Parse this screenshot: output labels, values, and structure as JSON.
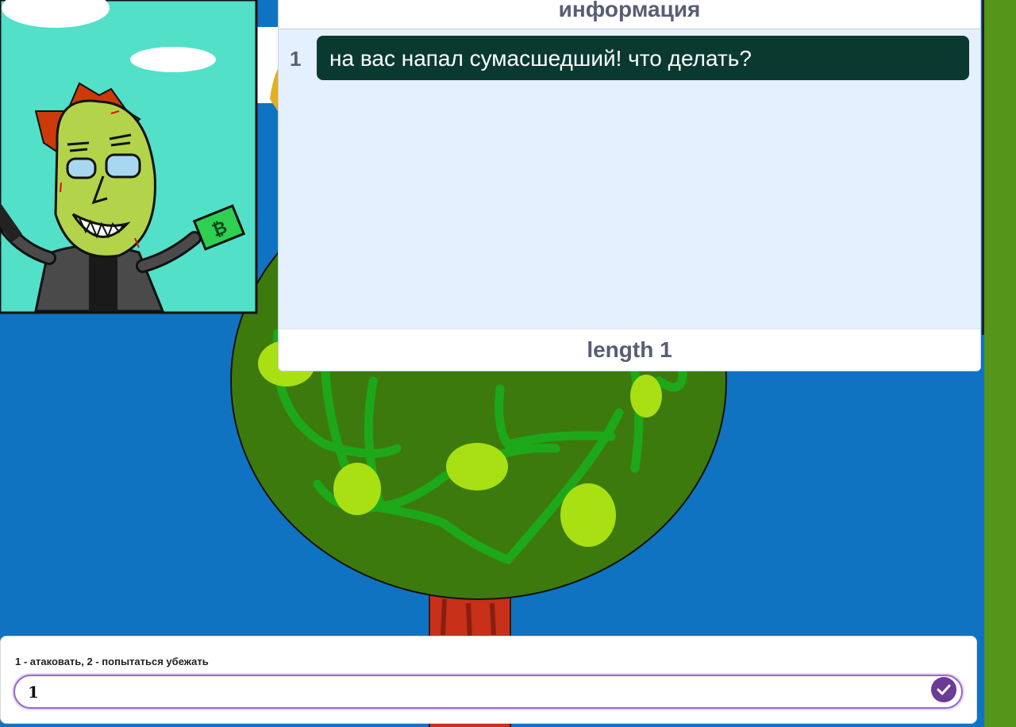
{
  "list_monitor": {
    "title": "информация",
    "items": [
      {
        "index": "1",
        "value": "на вас напал сумасшедший! что делать?"
      }
    ],
    "length_label": "length 1"
  },
  "ask": {
    "question": "1 - атаковать, 2 - попытаться убежать",
    "answer_value": "1"
  },
  "colors": {
    "stage_background": "#0f73c2",
    "sidebar": "#55961a",
    "list_item": "#0a3a2f",
    "submit_button": "#6b3b95"
  },
  "icons": {
    "submit": "checkmark-icon"
  }
}
